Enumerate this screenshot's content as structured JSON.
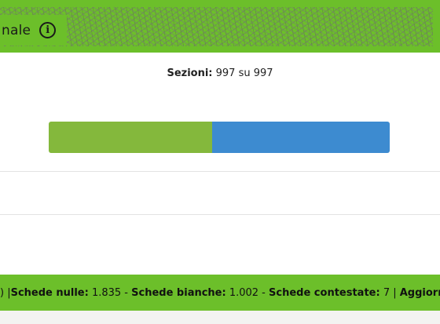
{
  "header": {
    "title_partial": "nale",
    "info_icon": "info-icon",
    "info_glyph": "i"
  },
  "sections": {
    "label": "Sezioni:",
    "value": "997 su 997"
  },
  "progress": {
    "segments": [
      {
        "fraction": 0.48,
        "color": "#84b83c"
      },
      {
        "fraction": 0.52,
        "color": "#3d8bd0"
      }
    ]
  },
  "footer": {
    "lead": ") | ",
    "null_label": "Schede nulle:",
    "null_value": " 1.835 - ",
    "blank_label": "Schede bianche:",
    "blank_value": " 1.002 - ",
    "contested_label": "Schede contestate:",
    "contested_value": " 7 | ",
    "updated_label": "Aggiornam"
  },
  "colors": {
    "accent_green": "#6cbf2a",
    "bar_green": "#84b83c",
    "bar_blue": "#3d8bd0"
  }
}
